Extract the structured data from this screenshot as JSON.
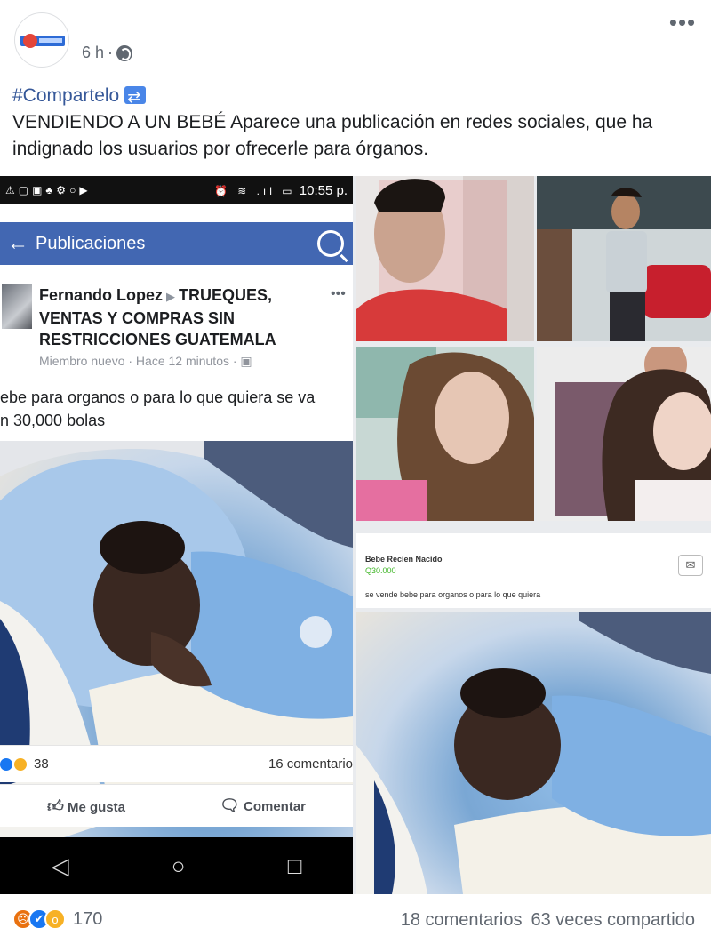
{
  "post": {
    "time": "6 h",
    "menu_glyph": "•••",
    "hashtag": "#Compartelo",
    "body": "VENDIENDO A UN BEBÉ Aparece una publicación en redes sociales, que ha indignado los usuarios por ofrecerle para órganos."
  },
  "embedded_phone": {
    "status_time": "10:55 p.",
    "status_icons": "⚠▢▣♣⚙○▶",
    "signal_icons": "⏰ ≋ .ıl ▭",
    "nav_back": "←",
    "nav_title": "Publicaciones",
    "author": "Fernando Lopez",
    "group": "TRUEQUES, VENTAS Y COMPRAS SIN RESTRICCIONES GUATEMALA",
    "meta": "Miembro nuevo · Hace 12 minutos · ▣",
    "dots": "•••",
    "text": "ebe para organos o para lo que quiera se va\nn 30,000 bolas",
    "reaction_count": "38",
    "comments": "16 comentario",
    "like_label": "Me gusta",
    "comment_label": "Comentar",
    "nav_back_glyph": "◁",
    "nav_home_glyph": "○",
    "nav_recent_glyph": "□"
  },
  "listing_card": {
    "title": "Bebe Recien Nacido",
    "price": "Q30.000",
    "text": "se vende bebe para organos o para lo que quiera",
    "messenger_icon": "messenger-icon"
  },
  "footer": {
    "reaction_count": "170",
    "comments": "18 comentarios",
    "shares": "63 veces compartido"
  },
  "colors": {
    "facebook_blue": "#4267b2",
    "link_blue": "#365899",
    "angry": "#e9710f",
    "like": "#1877f2",
    "wow": "#f7b125"
  }
}
